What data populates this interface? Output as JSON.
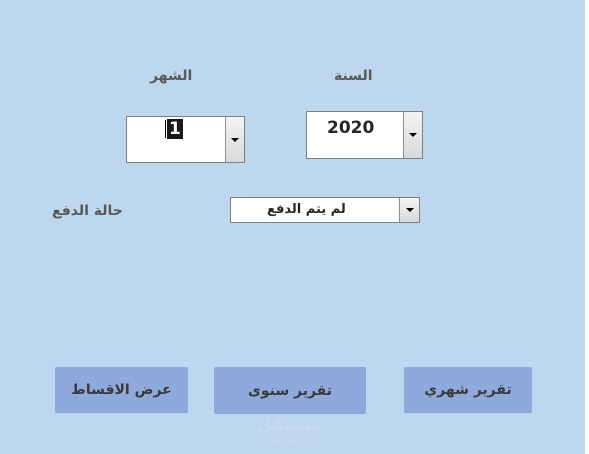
{
  "form": {
    "year_label": "السنة",
    "year_value": "2020",
    "month_label": "الشهر",
    "month_value": "1",
    "payment_status_label": "حالة الدفع",
    "payment_status_value": "لم يتم الدفع"
  },
  "buttons": {
    "monthly_report": "تقرير شهري",
    "yearly_report": "تقرير سنوى",
    "show_installments": "عرض الاقساط"
  },
  "watermark": {
    "text": "مستقل",
    "sub": "mostaql.com"
  },
  "colors": {
    "background": "#bdd7ee",
    "button": "#8ea9db"
  }
}
